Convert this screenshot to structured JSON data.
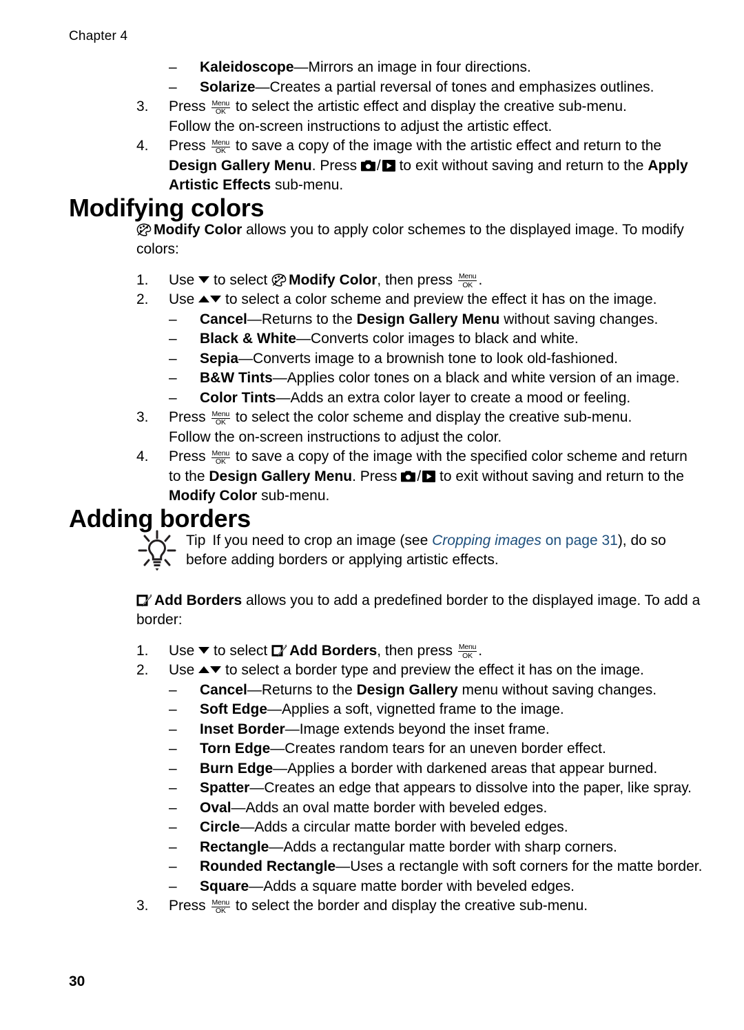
{
  "page": {
    "chapter_header": "Chapter 4",
    "folio": "30",
    "link_color": "#1d4f7c"
  },
  "icons": {
    "menu_ok_top": "Menu",
    "menu_ok_bottom": "OK",
    "slash": "/"
  },
  "artistic_effects": {
    "bullets": [
      {
        "dash": "–",
        "term": "Kaleidoscope",
        "sep": "—",
        "desc": "Mirrors an image in four directions."
      },
      {
        "dash": "–",
        "term": "Solarize",
        "sep": "—",
        "desc": "Creates a partial reversal of tones and emphasizes outlines."
      }
    ],
    "step3": {
      "num": "3.",
      "a": "Press ",
      "b": " to select the artistic effect and display the creative sub-menu.",
      "line2": "Follow the on-screen instructions to adjust the artistic effect."
    },
    "step4": {
      "num": "4.",
      "a": "Press ",
      "b": " to save a copy of the image with the artistic effect and return to the ",
      "c": "Design Gallery Menu",
      "d": ". Press ",
      "e": " to exit without saving and return to the ",
      "f": "Apply Artistic Effects",
      "g": " sub-menu."
    }
  },
  "modifying_colors": {
    "heading": "Modifying colors",
    "intro": {
      "a": "Modify Color",
      "b": " allows you to apply color schemes to the displayed image. To modify colors:"
    },
    "step1": {
      "num": "1.",
      "a": "Use ",
      "b": " to select ",
      "c": "Modify Color",
      "d": ", then press ",
      "e": "."
    },
    "step2": {
      "num": "2.",
      "a": "Use ",
      "b": " to select a color scheme and preview the effect it has on the image."
    },
    "schemes": [
      {
        "dash": "–",
        "term": "Cancel",
        "sep": "—",
        "desc_pre": "Returns to the ",
        "desc_bold": "Design Gallery Menu",
        "desc_post": " without saving changes."
      },
      {
        "dash": "–",
        "term": "Black & White",
        "sep": "—",
        "desc_pre": "Converts color images to black and white.",
        "desc_bold": "",
        "desc_post": ""
      },
      {
        "dash": "–",
        "term": "Sepia",
        "sep": "—",
        "desc_pre": "Converts image to a brownish tone to look old-fashioned.",
        "desc_bold": "",
        "desc_post": ""
      },
      {
        "dash": "–",
        "term": "B&W Tints",
        "sep": "—",
        "desc_pre": "Applies color tones on a black and white version of an image.",
        "desc_bold": "",
        "desc_post": ""
      },
      {
        "dash": "–",
        "term": "Color Tints",
        "sep": "—",
        "desc_pre": "Adds an extra color layer to create a mood or feeling.",
        "desc_bold": "",
        "desc_post": ""
      }
    ],
    "step3": {
      "num": "3.",
      "a": "Press ",
      "b": " to select the color scheme and display the creative sub-menu.",
      "line2": "Follow the on-screen instructions to adjust the color."
    },
    "step4": {
      "num": "4.",
      "a": "Press ",
      "b": " to save a copy of the image with the specified color scheme and return to the ",
      "c": "Design Gallery Menu",
      "d": ". Press ",
      "e": " to exit without saving and return to the ",
      "f": "Modify Color",
      "g": " sub-menu."
    }
  },
  "adding_borders": {
    "heading": "Adding borders",
    "tip": {
      "label": "Tip",
      "a": "If you need to crop an image (see ",
      "link_italic": "Cropping images",
      "link_rest": " on page 31",
      "b": "), do so before adding borders or applying artistic effects."
    },
    "intro": {
      "a": "Add Borders",
      "b": " allows you to add a predefined border to the displayed image. To add a border:"
    },
    "step1": {
      "num": "1.",
      "a": "Use ",
      "b": " to select ",
      "c": "Add Borders",
      "d": ", then press ",
      "e": "."
    },
    "step2": {
      "num": "2.",
      "a": "Use ",
      "b": " to select a border type and preview the effect it has on the image."
    },
    "border_types": [
      {
        "dash": "–",
        "term": "Cancel",
        "sep": "—",
        "desc_pre": "Returns to the ",
        "desc_bold": "Design Gallery",
        "desc_post": " menu without saving changes."
      },
      {
        "dash": "–",
        "term": "Soft Edge",
        "sep": "—",
        "desc_pre": "Applies a soft, vignetted frame to the image.",
        "desc_bold": "",
        "desc_post": ""
      },
      {
        "dash": "–",
        "term": "Inset Border",
        "sep": "—",
        "desc_pre": "Image extends beyond the inset frame.",
        "desc_bold": "",
        "desc_post": ""
      },
      {
        "dash": "–",
        "term": "Torn Edge",
        "sep": "—",
        "desc_pre": "Creates random tears for an uneven border effect.",
        "desc_bold": "",
        "desc_post": ""
      },
      {
        "dash": "–",
        "term": "Burn Edge",
        "sep": "—",
        "desc_pre": "Applies a border with darkened areas that appear burned.",
        "desc_bold": "",
        "desc_post": ""
      },
      {
        "dash": "–",
        "term": "Spatter",
        "sep": "—",
        "desc_pre": "Creates an edge that appears to dissolve into the paper, like spray.",
        "desc_bold": "",
        "desc_post": ""
      },
      {
        "dash": "–",
        "term": "Oval",
        "sep": "—",
        "desc_pre": "Adds an oval matte border with beveled edges.",
        "desc_bold": "",
        "desc_post": ""
      },
      {
        "dash": "–",
        "term": "Circle",
        "sep": "—",
        "desc_pre": "Adds a circular matte border with beveled edges.",
        "desc_bold": "",
        "desc_post": ""
      },
      {
        "dash": "–",
        "term": "Rectangle",
        "sep": "—",
        "desc_pre": "Adds a rectangular matte border with sharp corners.",
        "desc_bold": "",
        "desc_post": ""
      },
      {
        "dash": "–",
        "term": "Rounded Rectangle",
        "sep": "—",
        "desc_pre": "Uses a rectangle with soft corners for the matte border.",
        "desc_bold": "",
        "desc_post": ""
      },
      {
        "dash": "–",
        "term": "Square",
        "sep": "—",
        "desc_pre": "Adds a square matte border with beveled edges.",
        "desc_bold": "",
        "desc_post": ""
      }
    ],
    "step3": {
      "num": "3.",
      "a": "Press ",
      "b": " to select the border and display the creative sub-menu."
    }
  }
}
